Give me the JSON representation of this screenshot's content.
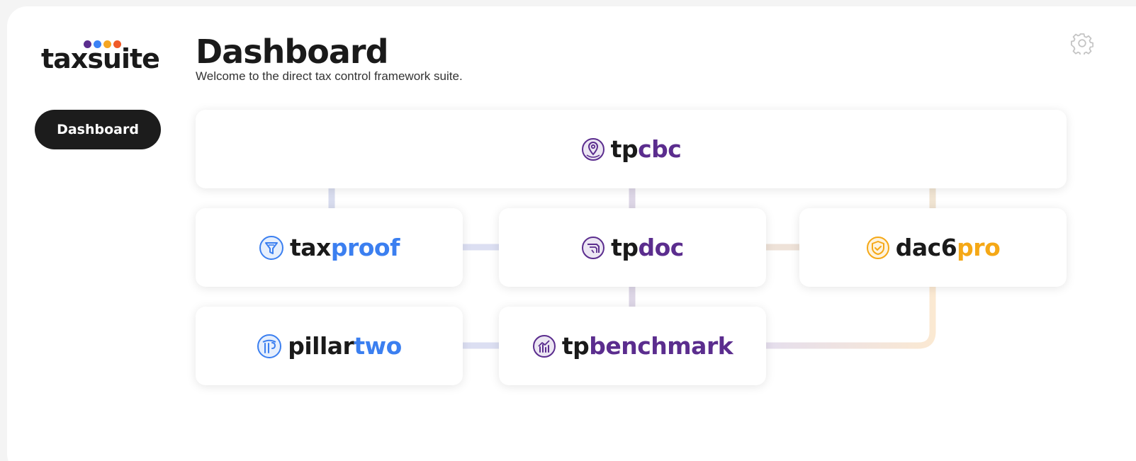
{
  "logo": {
    "text": "taxsuite",
    "dot_colors": [
      "#5b2d8e",
      "#3b82f6",
      "#f5a623",
      "#f05a28"
    ]
  },
  "sidebar": {
    "items": [
      {
        "label": "Dashboard",
        "active": true
      }
    ]
  },
  "header": {
    "title": "Dashboard",
    "subtitle": "Welcome to the direct tax control framework suite.",
    "settings_icon": "gear-icon"
  },
  "products": {
    "tpcbc": {
      "prefix": "tp",
      "suffix": "cbc",
      "icon": "globe-pin-icon",
      "accent": "#5b2d8e"
    },
    "taxproof": {
      "prefix": "tax",
      "suffix": "proof",
      "icon": "funnel-icon",
      "accent": "#3b7ff0"
    },
    "tpdoc": {
      "prefix": "tp",
      "suffix": "doc",
      "icon": "document-icon",
      "accent": "#5b2d8e"
    },
    "dac6pro": {
      "prefix": "dac6",
      "suffix": "pro",
      "icon": "shield-check-icon",
      "accent": "#f5a816"
    },
    "pillartwo": {
      "prefix": "pillar",
      "suffix": "two",
      "icon": "pillars-icon",
      "accent": "#3b7ff0"
    },
    "tpbenchmark": {
      "prefix": "tp",
      "suffix": "benchmark",
      "icon": "bar-chart-icon",
      "accent": "#5b2d8e"
    }
  }
}
